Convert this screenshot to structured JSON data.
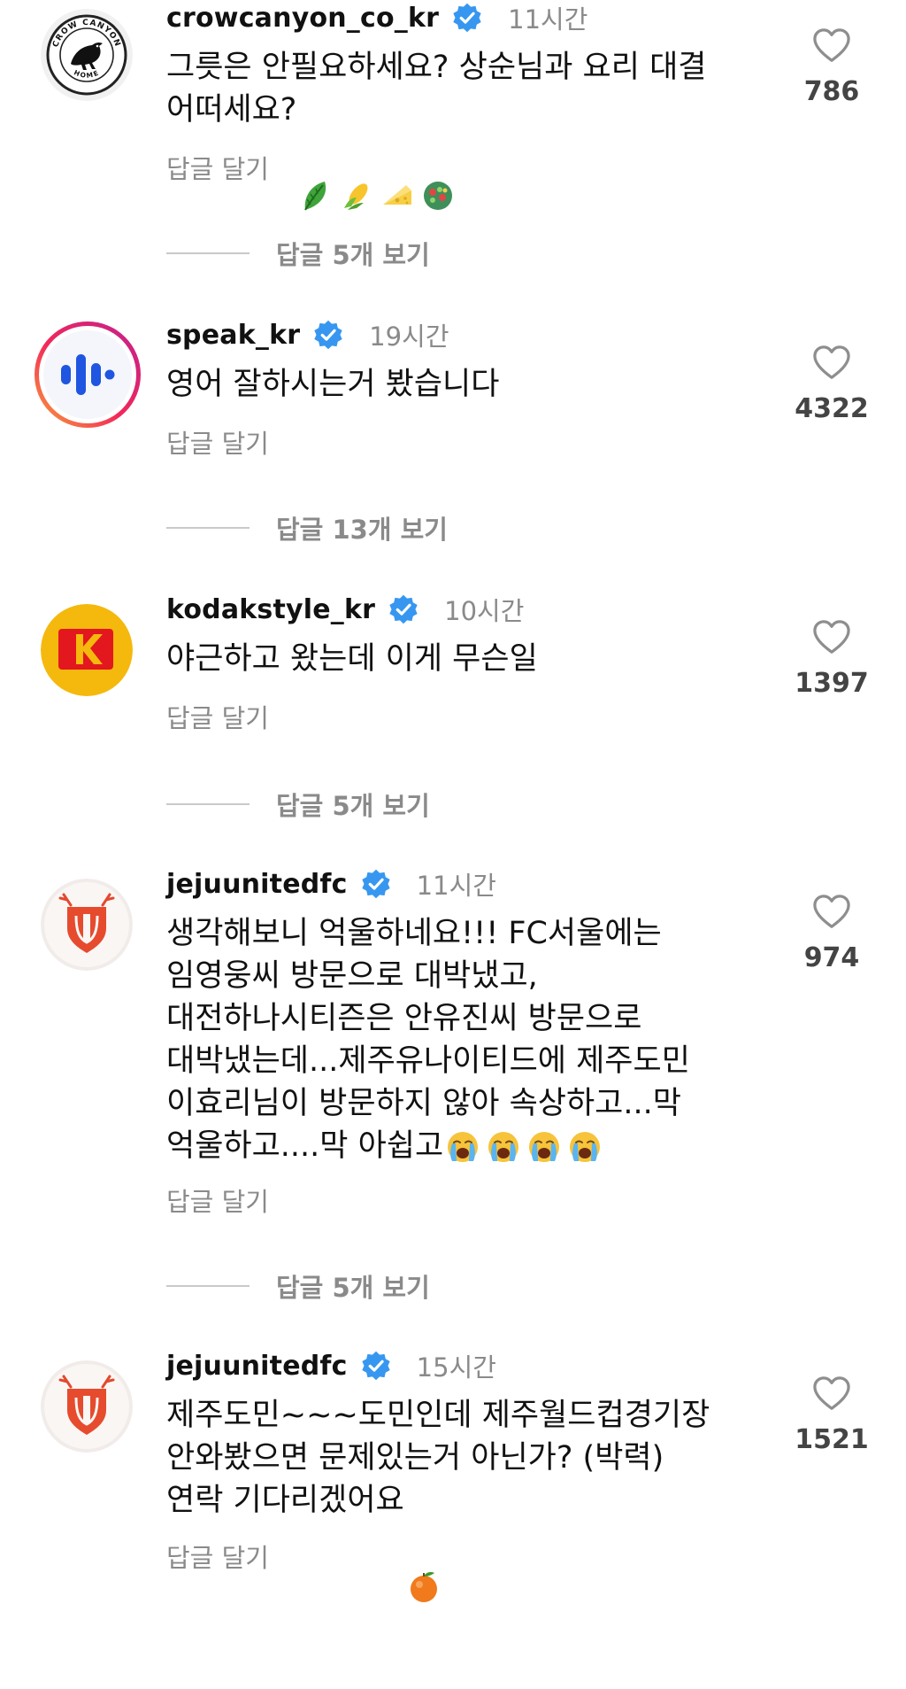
{
  "colors": {
    "verified_badge": "#3797f0",
    "muted_text": "#8a8a8a",
    "like_count": "#444444",
    "divider": "#c9c9c9"
  },
  "comments": [
    {
      "username": "crowcanyon_co_kr",
      "verified": true,
      "time": "11시간",
      "text": "그릇은 안필요하세요? 상순님과 요리 대결\n어떠세요?",
      "emojis": [
        "leafy-green",
        "corn",
        "cheese",
        "salad"
      ],
      "reply_label": "답글 달기",
      "likes": "786",
      "view_replies": "답글 5개 보기",
      "avatar": "crow-canyon-home-logo",
      "avatar_text": "CROW CANYON HOME"
    },
    {
      "username": "speak_kr",
      "verified": true,
      "time": "19시간",
      "text": "영어 잘하시는거 봤습니다",
      "reply_label": "답글 달기",
      "likes": "4322",
      "view_replies": "답글 13개 보기",
      "avatar": "speak-logo"
    },
    {
      "username": "kodakstyle_kr",
      "verified": true,
      "time": "10시간",
      "text": "야근하고 왔는데 이게 무슨일",
      "reply_label": "답글 달기",
      "likes": "1397",
      "view_replies": "답글 5개 보기",
      "avatar": "kodak-logo"
    },
    {
      "username": "jejuunitedfc",
      "verified": true,
      "time": "11시간",
      "text": "생각해보니 억울하네요!!! FC서울에는\n임영웅씨 방문으로 대박냈고,\n대전하나시티즌은 안유진씨 방문으로\n대박냈는데...제주유나이티드에 제주도민\n이효리님이 방문하지 않아 속상하고...막\n억울하고....막 아쉽고",
      "emojis": [
        "loudly-crying",
        "loudly-crying",
        "loudly-crying",
        "loudly-crying"
      ],
      "reply_label": "답글 달기",
      "likes": "974",
      "view_replies": "답글 5개 보기",
      "avatar": "jeju-united-crest"
    },
    {
      "username": "jejuunitedfc",
      "verified": true,
      "time": "15시간",
      "text": "제주도민~~~도민인데 제주월드컵경기장\n안와봤으면 문제있는거 아닌가? (박력)\n연락 기다리겠어요",
      "emojis": [
        "tangerine"
      ],
      "reply_label": "답글 달기",
      "likes": "1521",
      "avatar": "jeju-united-crest"
    }
  ]
}
